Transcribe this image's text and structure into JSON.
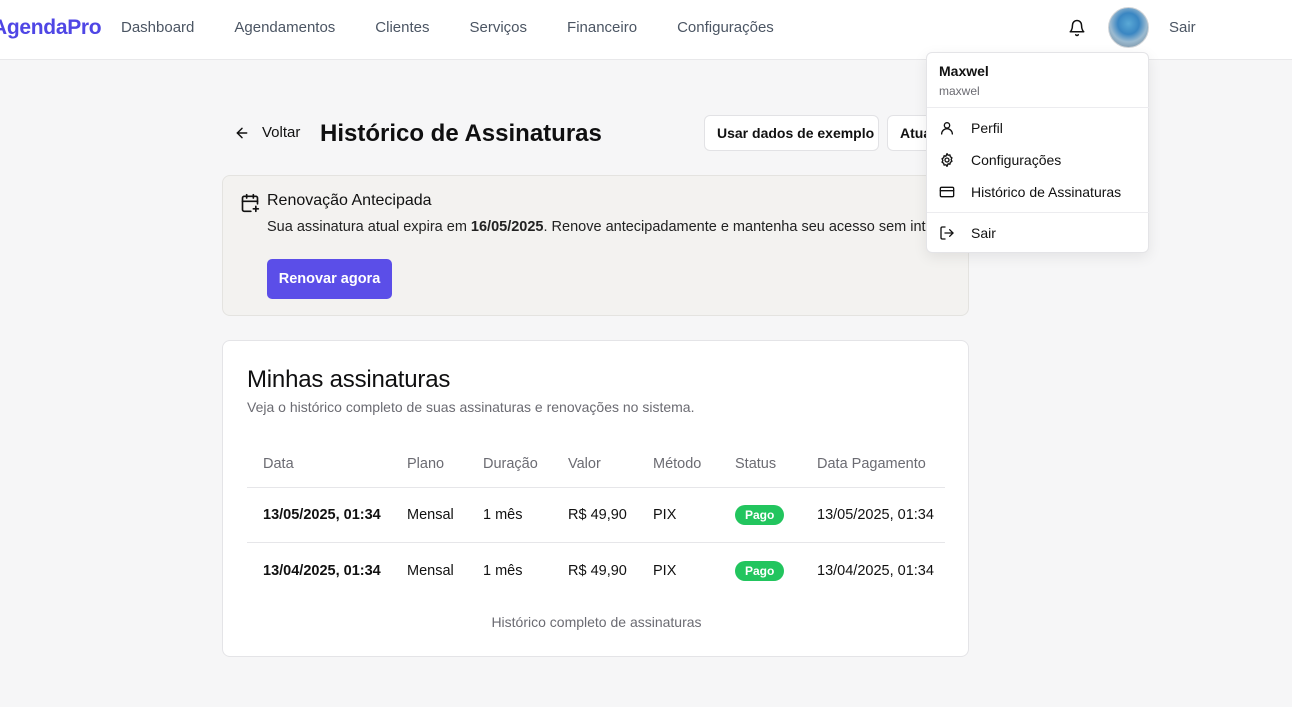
{
  "nav": {
    "brand": "AgendaPro",
    "links": [
      "Dashboard",
      "Agendamentos",
      "Clientes",
      "Serviços",
      "Financeiro",
      "Configurações"
    ],
    "logout": "Sair"
  },
  "header": {
    "back": "Voltar",
    "title": "Histórico de Assinaturas",
    "example_button": "Usar dados de exemplo",
    "update_button": "Atualizar"
  },
  "renewal": {
    "title": "Renovação Antecipada",
    "text_prefix": "Sua assinatura atual expira em ",
    "expiry_date": "16/05/2025",
    "text_suffix": ". Renove antecipadamente e mantenha seu acesso sem interrupções.",
    "button": "Renovar agora"
  },
  "subscriptions": {
    "title": "Minhas assinaturas",
    "description": "Veja o histórico completo de suas assinaturas e renovações no sistema.",
    "columns": [
      "Data",
      "Plano",
      "Duração",
      "Valor",
      "Método",
      "Status",
      "Data Pagamento"
    ],
    "rows": [
      [
        "13/05/2025, 01:34",
        "Mensal",
        "1 mês",
        "R$ 49,90",
        "PIX",
        "Pago",
        "13/05/2025, 01:34"
      ],
      [
        "13/04/2025, 01:34",
        "Mensal",
        "1 mês",
        "R$ 49,90",
        "PIX",
        "Pago",
        "13/04/2025, 01:34"
      ]
    ],
    "caption": "Histórico completo de assinaturas",
    "status_color": "#22c55e"
  },
  "user_menu": {
    "name": "Maxwel",
    "username": "maxwel",
    "items": [
      {
        "label": "Perfil",
        "icon": "user-icon"
      },
      {
        "label": "Configurações",
        "icon": "gear-icon"
      },
      {
        "label": "Histórico de Assinaturas",
        "icon": "credit-card-icon"
      }
    ],
    "logout": {
      "label": "Sair",
      "icon": "logout-icon"
    }
  },
  "colors": {
    "accent": "#5b4ee8",
    "brand": "#4f46e5"
  }
}
